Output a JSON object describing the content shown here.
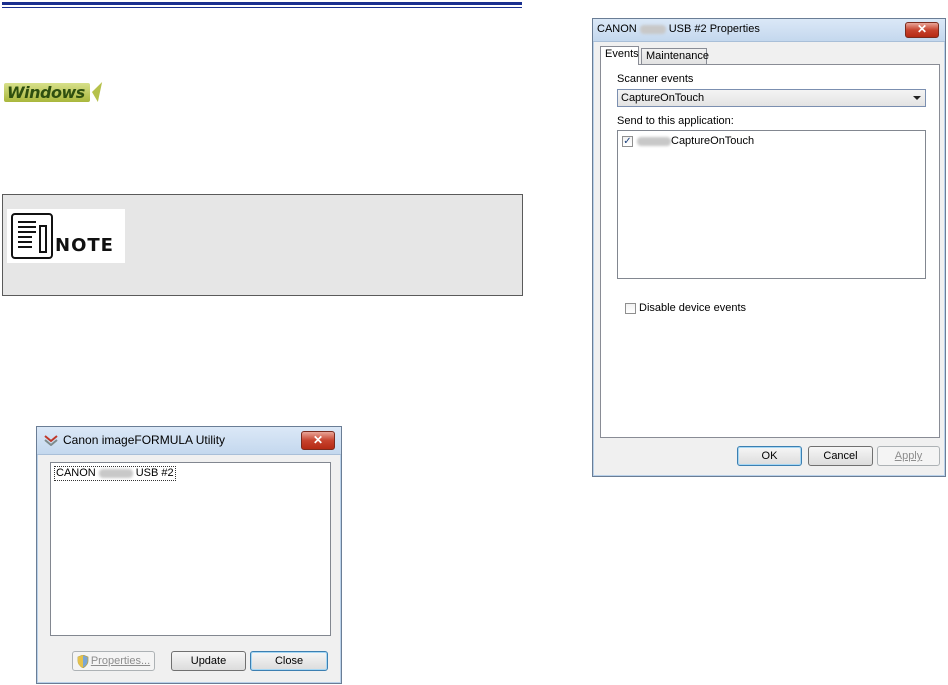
{
  "document": {
    "windows_badge": "Windows",
    "note_label": "NOTE"
  },
  "utility_dialog": {
    "title": "Canon imageFORMULA Utility",
    "close_glyph": "✕",
    "device_prefix": "CANON",
    "device_suffix": "USB #2",
    "buttons": {
      "properties": "Properties...",
      "update": "Update",
      "close": "Close"
    }
  },
  "properties_dialog": {
    "title_prefix": "CANON",
    "title_suffix": "USB #2 Properties",
    "close_glyph": "✕",
    "tabs": [
      "Events",
      "Maintenance"
    ],
    "scanner_events_label": "Scanner events",
    "scanner_events_value": "CaptureOnTouch",
    "send_to_label": "Send to this application:",
    "application_item": "CaptureOnTouch",
    "application_checked": true,
    "disable_events_label": "Disable device events",
    "disable_events_checked": false,
    "buttons": {
      "ok": "OK",
      "cancel": "Cancel",
      "apply": "Apply"
    }
  },
  "colors": {
    "rule_blue": "#1a2f8f",
    "note_bg": "#e6e6e6",
    "close_red": "#c7432e",
    "dialog_bg": "#f0f0f0"
  }
}
